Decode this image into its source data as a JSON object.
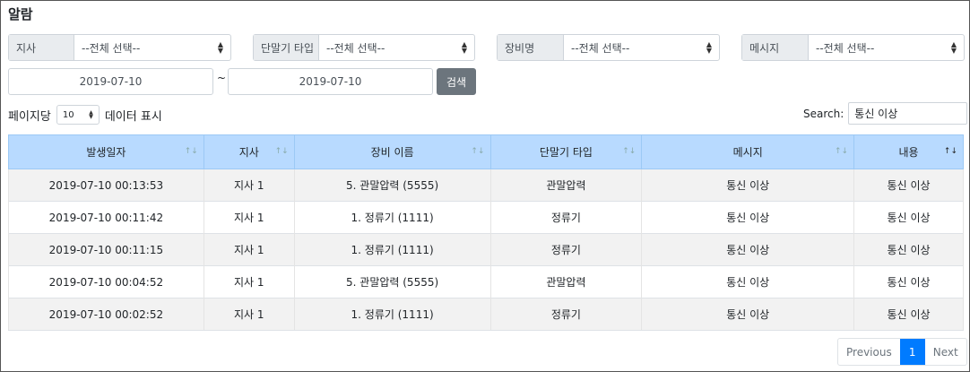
{
  "page_title": "알람",
  "filters": [
    {
      "label": "지사",
      "value": "--전체 선택--"
    },
    {
      "label": "단말기 타입",
      "value": "--전체 선택--"
    },
    {
      "label": "장비명",
      "value": "--전체 선택--"
    },
    {
      "label": "메시지",
      "value": "--전체 선택--"
    }
  ],
  "date_from": "2019-07-10",
  "date_sep": "~",
  "date_to": "2019-07-10",
  "search_button": "검색",
  "per_page": {
    "prefix": "페이지당",
    "value": "10",
    "suffix": "데이터 표시"
  },
  "search": {
    "label": "Search:",
    "value": "통신 이상"
  },
  "table": {
    "columns": [
      "발생일자",
      "지사",
      "장비 이름",
      "단말기 타입",
      "메시지",
      "내용"
    ],
    "rows": [
      [
        "2019-07-10 00:13:53",
        "지사 1",
        "5. 관말압력 (5555)",
        "관말압력",
        "통신 이상",
        "통신 이상"
      ],
      [
        "2019-07-10 00:11:42",
        "지사 1",
        "1. 정류기 (1111)",
        "정류기",
        "통신 이상",
        "통신 이상"
      ],
      [
        "2019-07-10 00:11:15",
        "지사 1",
        "1. 정류기 (1111)",
        "정류기",
        "통신 이상",
        "통신 이상"
      ],
      [
        "2019-07-10 00:04:52",
        "지사 1",
        "5. 관말압력 (5555)",
        "관말압력",
        "통신 이상",
        "통신 이상"
      ],
      [
        "2019-07-10 00:02:52",
        "지사 1",
        "1. 정류기 (1111)",
        "정류기",
        "통신 이상",
        "통신 이상"
      ]
    ]
  },
  "pagination": {
    "previous": "Previous",
    "current": "1",
    "next": "Next"
  }
}
